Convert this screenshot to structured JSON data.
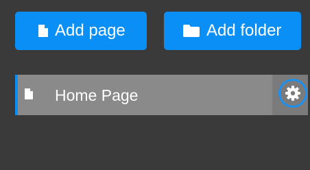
{
  "toolbar": {
    "add_page_label": "Add page",
    "add_folder_label": "Add folder"
  },
  "pages": [
    {
      "label": "Home Page",
      "icon": "file-icon",
      "action_icon": "gear-icon"
    }
  ],
  "colors": {
    "background": "#3a3a3a",
    "accent": "#0a8ff7",
    "row_background": "#8a8a8a",
    "gear_panel": "#7b7b7b",
    "gear_ring": "#1b90f0",
    "text": "#ffffff"
  }
}
